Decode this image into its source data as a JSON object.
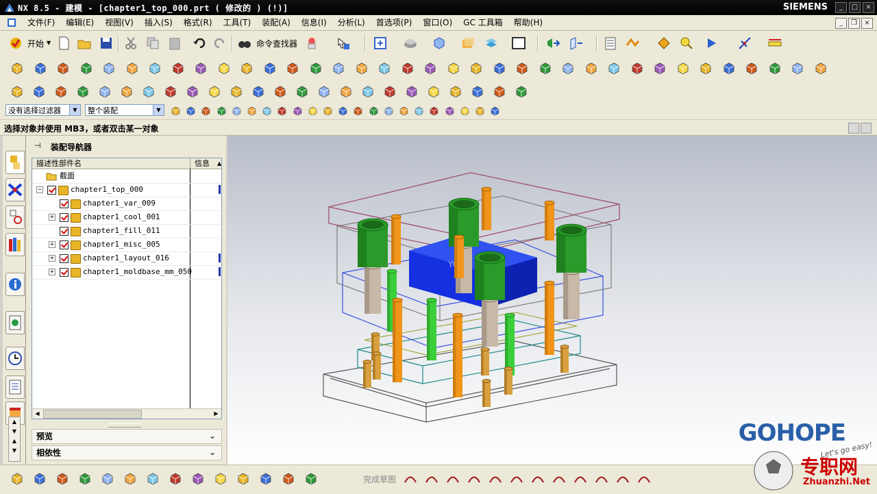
{
  "titlebar": {
    "title": "NX 8.5 - 建模 - [chapter1_top_000.prt ( 修改的 )      (!)]",
    "brand": "SIEMENS"
  },
  "menubar": {
    "items": [
      "文件(F)",
      "编辑(E)",
      "视图(V)",
      "插入(S)",
      "格式(R)",
      "工具(T)",
      "装配(A)",
      "信息(I)",
      "分析(L)",
      "首选项(P)",
      "窗口(O)",
      "GC 工具箱",
      "帮助(H)"
    ]
  },
  "toolbar": {
    "start_label": "开始",
    "command_finder_label": "命令查找器"
  },
  "selection": {
    "filter_value": "没有选择过滤器",
    "scope_value": "整个装配"
  },
  "cue_line": "选择对象并使用 MB3，或者双击某一对象",
  "navigator": {
    "title": "装配导航器",
    "columns": [
      "描述性部件名",
      "信息"
    ],
    "section_folder": "截面",
    "root": "chapter1_top_000",
    "children": [
      {
        "name": "chapter1_var_009",
        "expandable": false
      },
      {
        "name": "chapter1_cool_001",
        "expandable": true
      },
      {
        "name": "chapter1_fill_011",
        "expandable": false
      },
      {
        "name": "chapter1_misc_005",
        "expandable": true
      },
      {
        "name": "chapter1_layout_016",
        "expandable": true
      },
      {
        "name": "chapter1_moldbase_mm_050",
        "expandable": true
      }
    ],
    "sections": [
      "预览",
      "相依性"
    ]
  },
  "bottombar": {
    "finish_sketch_label": "完成草图"
  },
  "watermark": {
    "brand": "GOHOPE",
    "tagline": "Let's go easy!",
    "site_cn": "专职网",
    "site_url": "Zhuanzhi.Net"
  },
  "colors": {
    "cavity_blue": "#1028e0",
    "guide_green": "#22aa22",
    "pin_orange": "#e08a10",
    "brand_blue": "#2a5fa8"
  }
}
